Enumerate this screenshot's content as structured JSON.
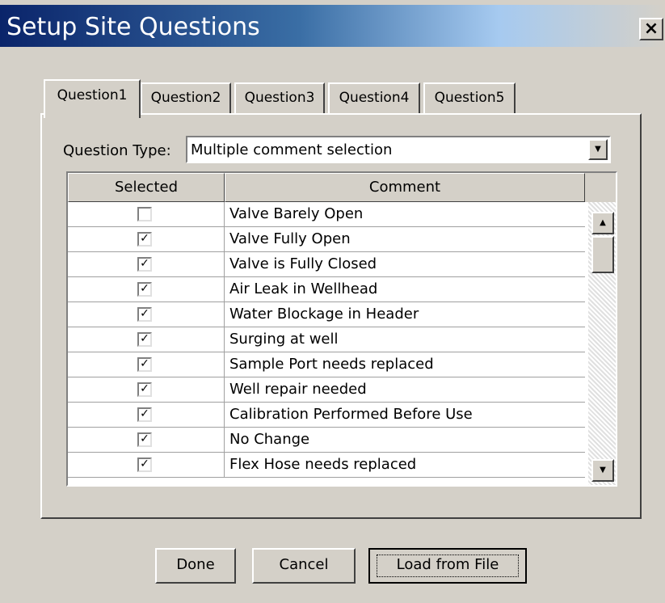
{
  "window": {
    "title": "Setup Site Questions",
    "close_symbol": "×"
  },
  "tabs": [
    {
      "label": "Question1",
      "active": true
    },
    {
      "label": "Question2",
      "active": false
    },
    {
      "label": "Question3",
      "active": false
    },
    {
      "label": "Question4",
      "active": false
    },
    {
      "label": "Question5",
      "active": false
    }
  ],
  "question_type": {
    "label": "Question Type:",
    "value": "Multiple comment selection",
    "arrow": "▼"
  },
  "grid": {
    "headers": {
      "selected": "Selected",
      "comment": "Comment"
    },
    "rows": [
      {
        "selected": false,
        "comment": "Valve Barely Open"
      },
      {
        "selected": true,
        "comment": "Valve Fully Open"
      },
      {
        "selected": true,
        "comment": "Valve is Fully Closed"
      },
      {
        "selected": true,
        "comment": "Air Leak in Wellhead"
      },
      {
        "selected": true,
        "comment": "Water Blockage in Header"
      },
      {
        "selected": true,
        "comment": "Surging at well"
      },
      {
        "selected": true,
        "comment": "Sample Port needs replaced"
      },
      {
        "selected": true,
        "comment": "Well repair needed"
      },
      {
        "selected": true,
        "comment": "Calibration Performed Before Use"
      },
      {
        "selected": true,
        "comment": "No Change"
      },
      {
        "selected": true,
        "comment": "Flex Hose needs replaced"
      }
    ],
    "check_glyph": "✓",
    "scroll_up": "▲",
    "scroll_down": "▼"
  },
  "buttons": {
    "done": "Done",
    "cancel": "Cancel",
    "load": "Load from File"
  },
  "colors": {
    "face": "#d4d0c8",
    "title_start": "#0a246a",
    "title_end": "#a6caf0"
  }
}
